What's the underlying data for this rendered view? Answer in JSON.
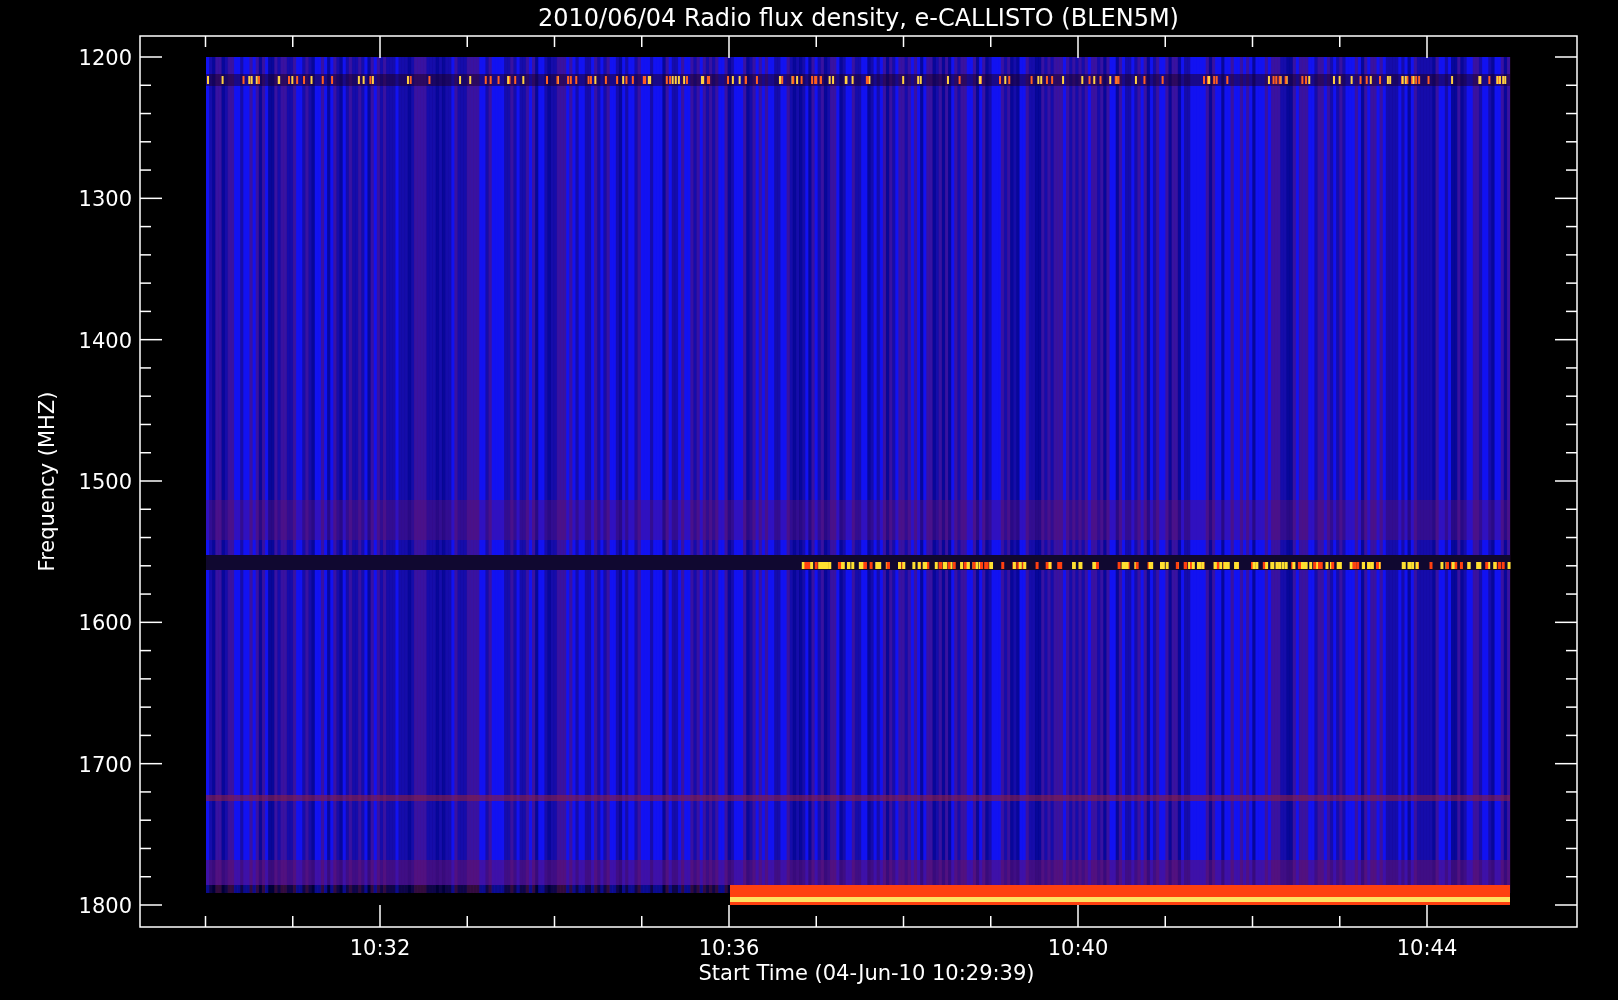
{
  "plot": {
    "title": "2010/06/04  Radio flux density, e-CALLISTO (BLEN5M)",
    "ylabel": "Frequency (MHZ)",
    "xlabel": "Start Time (04-Jun-10 10:29:39)",
    "yticks": [
      "1200",
      "1300",
      "1400",
      "1500",
      "1600",
      "1700",
      "1800"
    ],
    "xticks": [
      "10:32",
      "10:36",
      "10:40",
      "10:44"
    ]
  }
}
